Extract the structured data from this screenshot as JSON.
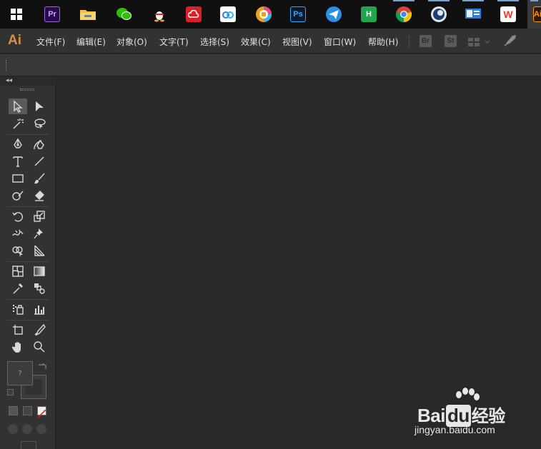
{
  "taskbar": {
    "apps": [
      {
        "name": "start",
        "icon": "windows-logo-icon",
        "label": ""
      },
      {
        "name": "premiere",
        "icon": "premiere-icon",
        "label": "Pr",
        "color": "#2a0a4a",
        "fg": "#c9a6ff"
      },
      {
        "name": "explorer",
        "icon": "folder-icon",
        "label": ""
      },
      {
        "name": "wechat",
        "icon": "wechat-icon",
        "label": ""
      },
      {
        "name": "qq",
        "icon": "qq-penguin-icon",
        "label": ""
      },
      {
        "name": "creative-cloud",
        "icon": "creative-cloud-icon",
        "label": ""
      },
      {
        "name": "netdisk",
        "icon": "cloud-storage-icon",
        "label": ""
      },
      {
        "name": "colorful-app",
        "icon": "circle-app-icon",
        "label": ""
      },
      {
        "name": "photoshop",
        "icon": "photoshop-icon",
        "label": "Ps",
        "color": "#0a1a2e",
        "fg": "#31a8ff"
      },
      {
        "name": "messenger",
        "icon": "paper-plane-icon",
        "label": ""
      },
      {
        "name": "hbuilder",
        "icon": "hbuilder-icon",
        "label": "H",
        "color": "#1fa54a",
        "fg": "#ffffff"
      },
      {
        "name": "chrome",
        "icon": "chrome-icon",
        "label": ""
      },
      {
        "name": "cinema4d",
        "icon": "cinema4d-icon",
        "label": ""
      },
      {
        "name": "remote",
        "icon": "remote-desktop-icon",
        "label": ""
      },
      {
        "name": "wps",
        "icon": "wps-icon",
        "label": "W",
        "color": "#ffffff",
        "fg": "#e8392b"
      },
      {
        "name": "illustrator",
        "icon": "illustrator-icon",
        "label": "Ai",
        "color": "#2b1a08",
        "fg": "#ff9a00"
      }
    ]
  },
  "menubar": {
    "logo": "Ai",
    "items": [
      "文件(F)",
      "编辑(E)",
      "对象(O)",
      "文字(T)",
      "选择(S)",
      "效果(C)",
      "视图(V)",
      "窗口(W)",
      "帮助(H)"
    ],
    "bridge_label": "Br",
    "stock_label": "St"
  },
  "toolbar": {
    "collapse_glyph": "◂◂",
    "fill_placeholder": "?",
    "tools": [
      "selection-tool",
      "direct-selection-tool",
      "magic-wand-tool",
      "lasso-tool",
      "pen-tool",
      "curvature-tool",
      "type-tool",
      "line-segment-tool",
      "rectangle-tool",
      "paintbrush-tool",
      "shaper-tool",
      "eraser-tool",
      "rotate-tool",
      "scale-tool",
      "width-tool",
      "puppet-warp-tool",
      "shape-builder-tool",
      "perspective-grid-tool",
      "mesh-tool",
      "gradient-tool",
      "eyedropper-tool",
      "blend-tool",
      "symbol-sprayer-tool",
      "column-graph-tool",
      "artboard-tool",
      "slice-tool",
      "hand-tool",
      "zoom-tool"
    ]
  },
  "watermark": {
    "brand": "Bai",
    "brand2": "du",
    "brand_suffix": "经验",
    "url": "jingyan.baidu.com"
  }
}
